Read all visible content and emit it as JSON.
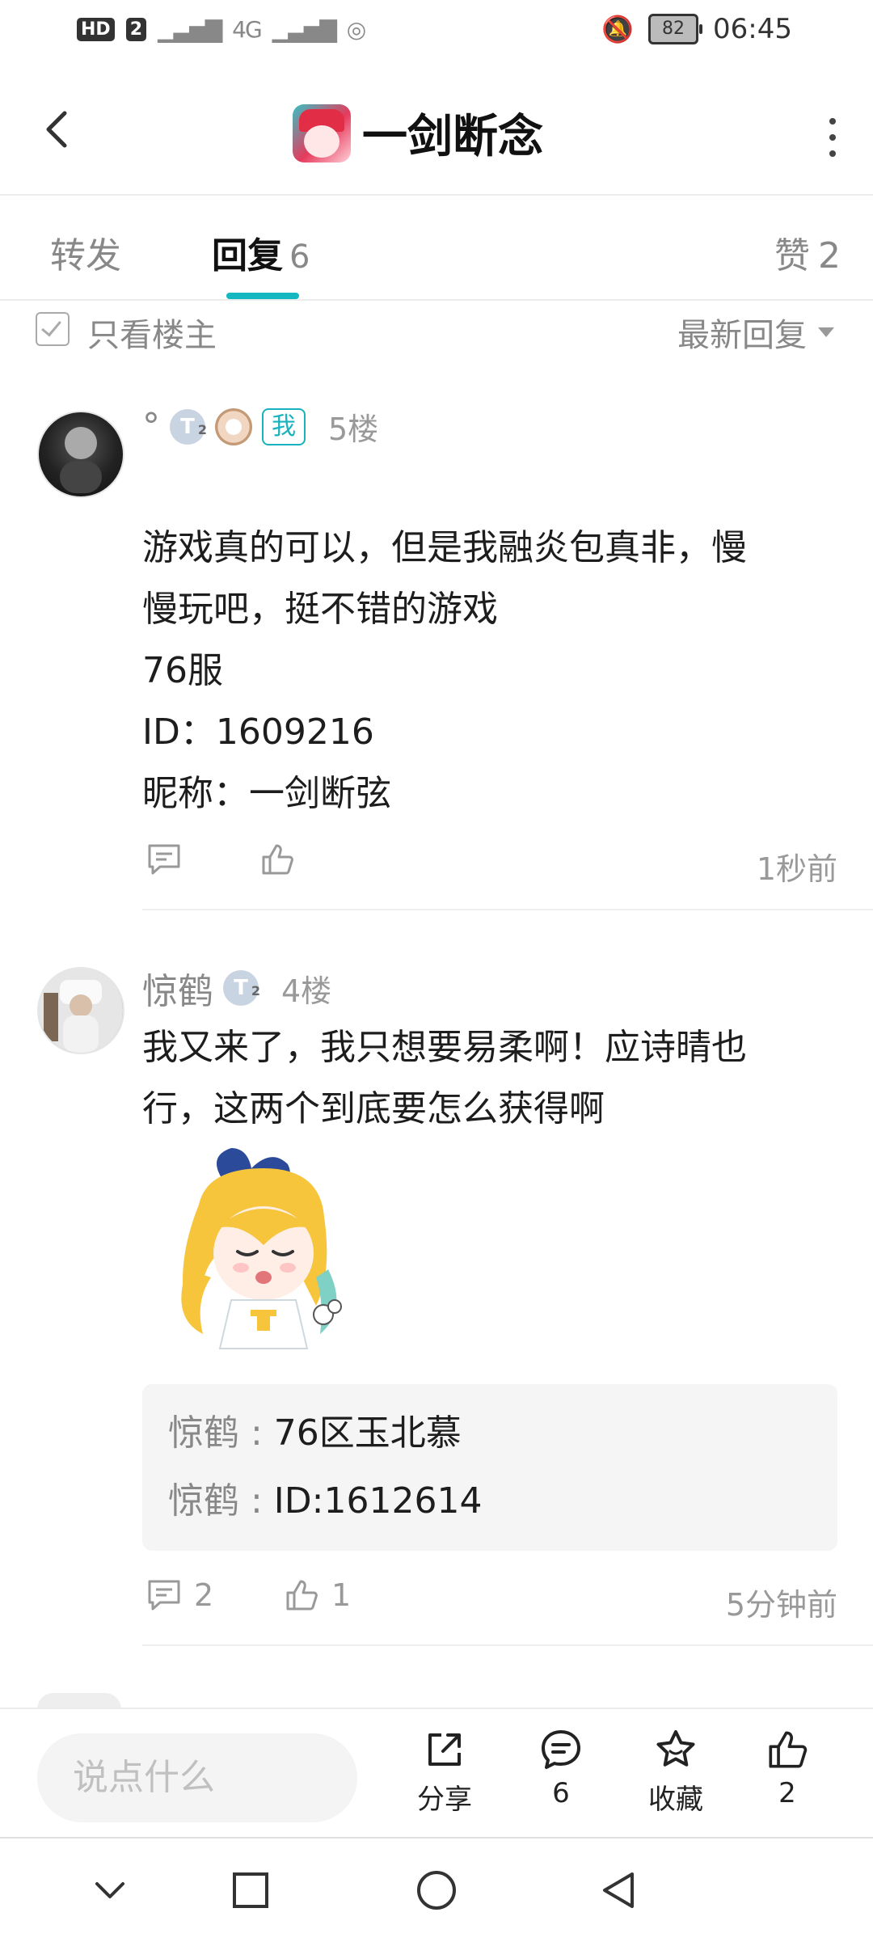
{
  "status_bar": {
    "net": "HD",
    "net_sim": "2",
    "signal": "4G",
    "battery": "82",
    "time": "06:45"
  },
  "header": {
    "title": "一剑断念"
  },
  "tabs": {
    "repost": "转发",
    "reply": "回复",
    "reply_count": "6",
    "like": "赞",
    "like_count": "2"
  },
  "filter": {
    "only_op": "只看楼主",
    "sort": "最新回复"
  },
  "posts": [
    {
      "username": "°",
      "level": "T",
      "level_sub": "2",
      "me_badge": "我",
      "floor": "5楼",
      "lines": [
        "游戏真的可以，但是我融炎包真非，慢",
        "慢玩吧，挺不错的游戏",
        "76服",
        "ID：1609216",
        "昵称：一剑断弦"
      ],
      "time": "1秒前"
    },
    {
      "username": "惊鹤",
      "level": "T",
      "level_sub": "2",
      "floor": "4楼",
      "lines": [
        "我又来了，我只想要易柔啊！应诗晴也",
        "行，这两个到底要怎么获得啊"
      ],
      "sub_replies": [
        {
          "who": "惊鹤",
          "sep": " : ",
          "text": "76区玉北慕"
        },
        {
          "who": "惊鹤",
          "sep": " : ",
          "text": "ID:1612614"
        }
      ],
      "comment_count": "2",
      "like_count": "1",
      "time": "5分钟前"
    }
  ],
  "bottom_bar": {
    "placeholder": "说点什么",
    "share": "分享",
    "comments": "6",
    "favorite": "收藏",
    "likes": "2"
  }
}
